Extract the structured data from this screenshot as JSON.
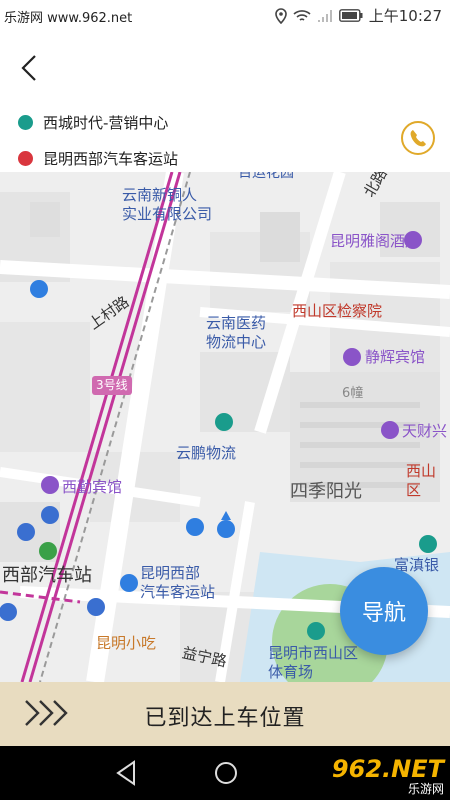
{
  "status_bar": {
    "watermark_text": "乐游网 www.962.net",
    "time": "上午10:27"
  },
  "header": {
    "back_icon": "chevron-left-icon",
    "origin": {
      "label": "西城时代-营销中心",
      "color": "#1a9c8c"
    },
    "destination": {
      "label": "昆明西部汽车客运站",
      "color": "#d9363e"
    },
    "phone_icon": "phone-icon"
  },
  "map": {
    "labels": {
      "p1": "云南新铜人",
      "p1b": "实业有限公司",
      "hotel1": "昆明雅阁酒店",
      "road1": "上村路",
      "logistics1": "云南医药",
      "logistics1b": "物流中心",
      "gov": "西山区检察院",
      "hotel2": "静辉宾馆",
      "building6": "6幢",
      "metro": "3号线",
      "logistics2": "云鹏物流",
      "hotel3": "天财兴",
      "gov2": "西山区",
      "hotel4": "西勤宾馆",
      "area": "四季阳光",
      "bank": "富滇银行",
      "station_big": "西部汽车站",
      "station": "昆明西部",
      "stationb": "汽车客运站",
      "snack": "昆明小吃",
      "road2": "益宁路",
      "gym": "昆明市西山区",
      "gymb": "体育场",
      "road3": "北路",
      "top_cut": "百运花园"
    },
    "navigate_label": "导航"
  },
  "bottom_bar": {
    "label": "已到达上车位置",
    "icon": "triple-chevron-right-icon"
  },
  "system_nav": {
    "back_icon": "triangle-back-icon",
    "home_icon": "circle-home-icon",
    "watermark": "962.NET",
    "watermark_sub": "乐游网"
  }
}
